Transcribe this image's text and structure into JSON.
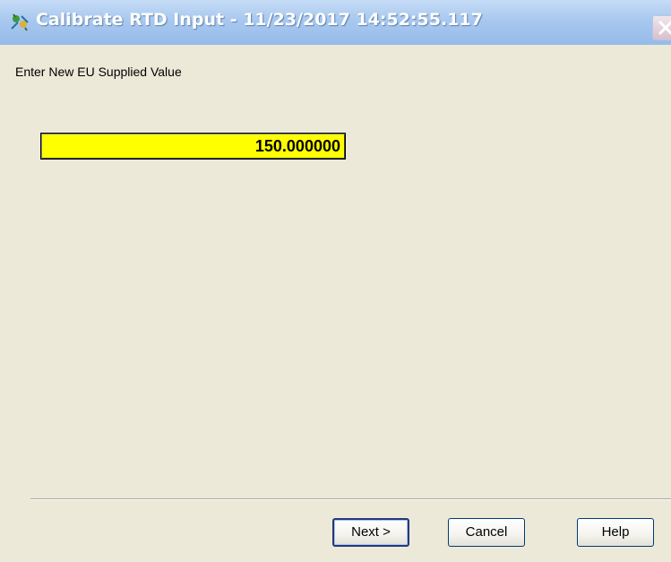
{
  "window": {
    "title": "Calibrate RTD Input - 11/23/2017 14:52:55.117",
    "icon": "calibration-app-icon"
  },
  "form": {
    "prompt": "Enter New EU Supplied Value",
    "value": "150.000000",
    "value_background": "#ffff00"
  },
  "buttons": {
    "next_label": "Next >",
    "cancel_label": "Cancel",
    "help_label": "Help"
  },
  "colors": {
    "titlebar": "#a8c8ef",
    "dialog_background": "#ece9d8",
    "field_highlight": "#ffff00"
  }
}
